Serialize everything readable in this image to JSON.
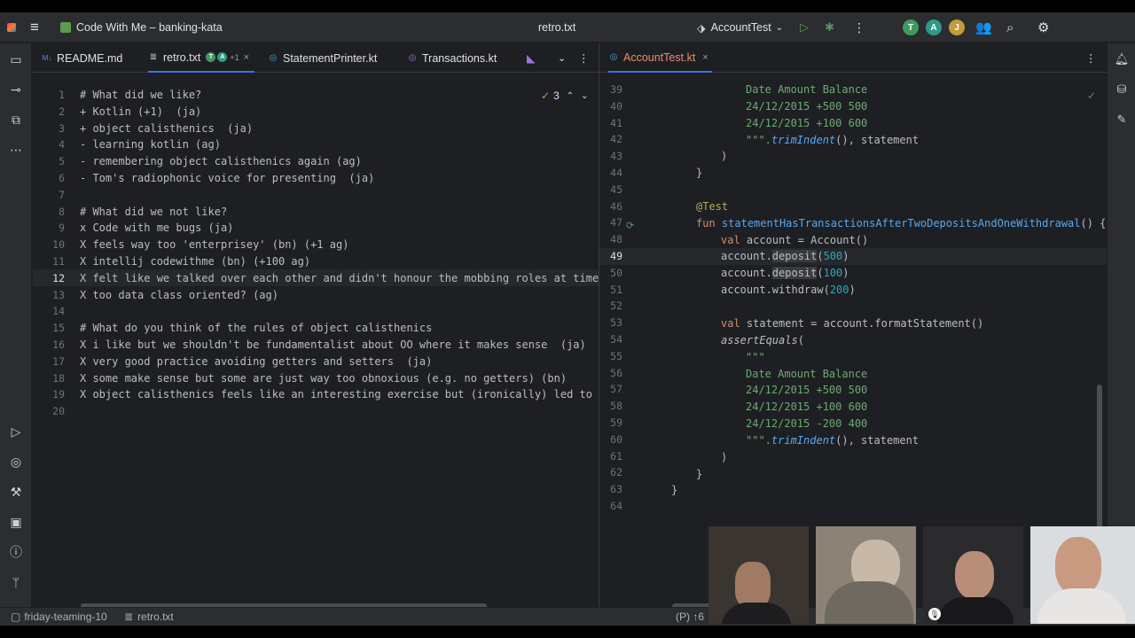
{
  "titlebar": {
    "project": "Code With Me – banking-kata",
    "center_file": "retro.txt",
    "run_config": "AccountTest",
    "avatars": [
      {
        "letter": "T",
        "color": "#3f9b5c"
      },
      {
        "letter": "A",
        "color": "#2f9a87"
      },
      {
        "letter": "J",
        "color": "#c59a3a"
      }
    ]
  },
  "left_tabs": {
    "tab1": "README.md",
    "tab2": "retro.txt",
    "tab2_badge": "+1",
    "tab3": "StatementPrinter.kt",
    "tab4": "Transactions.kt",
    "problems_count": "3"
  },
  "right_tabs": {
    "tab1": "AccountTest.kt"
  },
  "retro": {
    "line_numbers": [
      "1",
      "2",
      "3",
      "4",
      "5",
      "6",
      "7",
      "8",
      "9",
      "10",
      "11",
      "12",
      "13",
      "14",
      "15",
      "16",
      "17",
      "18",
      "19",
      "20"
    ],
    "lines": [
      "# What did we like?",
      "+ Kotlin (+1)  (ja)",
      "+ object calisthenics  (ja)",
      "- learning kotlin (ag)",
      "- remembering object calisthenics again (ag)",
      "- Tom's radiophonic voice for presenting  (ja)",
      "",
      "# What did we not like?",
      "x Code with me bugs (ja)",
      "X feels way too 'enterprisey' (bn) (+1 ag)",
      "X intellij codewithme (bn) (+100 ag)",
      "X felt like we talked over each other and didn't honour the mobbing roles at times (",
      "X too data class oriented? (ag)",
      "",
      "# What do you think of the rules of object calisthenics",
      "X i like but we shouldn't be fundamentalist about OO where it makes sense  (ja)",
      "X very good practice avoiding getters and setters  (ja)",
      "X some make sense but some are just way too obnoxious (e.g. no getters) (bn)",
      "X object calisthenics feels like an interesting exercise but (ironically) led to ble",
      ""
    ]
  },
  "test": {
    "line_numbers": [
      "39",
      "40",
      "41",
      "42",
      "43",
      "44",
      "45",
      "46",
      "47",
      "48",
      "49",
      "50",
      "51",
      "52",
      "53",
      "54",
      "55",
      "56",
      "57",
      "58",
      "59",
      "60",
      "61",
      "62",
      "63",
      "64"
    ],
    "l39": "Date Amount Balance",
    "l40": "24/12/2015 +500 500",
    "l41": "24/12/2015 +100 600",
    "l42_a": "\"\"\".",
    "l42_b": "trimIndent",
    "l42_c": "(), statement",
    "l43": ")",
    "l44": "}",
    "l46": "@Test",
    "l47_kw": "fun",
    "l47_fn": "statementHasTransactionsAfterTwoDepositsAndOneWithdrawal",
    "l47_rest": "() {",
    "l48_kw": "val",
    "l48_rest": "account = Account()",
    "l49_a": "account.",
    "l49_b": "deposit",
    "l49_c": "(",
    "l49_n": "500",
    "l49_d": ")",
    "l50_a": "account.",
    "l50_b": "deposit",
    "l50_c": "(",
    "l50_n": "100",
    "l50_d": ")",
    "l51_a": "account.withdraw(",
    "l51_n": "200",
    "l51_d": ")",
    "l53_kw": "val",
    "l53_rest": "statement = account.formatStatement()",
    "l54_fn": "assertEquals",
    "l54_rest": "(",
    "l55": "\"\"\"",
    "l56": "Date Amount Balance",
    "l57": "24/12/2015 +500 500",
    "l58": "24/12/2015 +100 600",
    "l59": "24/12/2015 -200 400",
    "l60_a": "\"\"\".",
    "l60_b": "trimIndent",
    "l60_c": "(), statement",
    "l61": ")",
    "l62": "}",
    "l63": "}"
  },
  "status": {
    "branch": "friday-teaming-10",
    "file": "retro.txt",
    "right": "(P) ↑6"
  },
  "video": {
    "colors": [
      "#3a3530",
      "#8c8276",
      "#2b2b2e",
      "#d9dde0"
    ]
  }
}
